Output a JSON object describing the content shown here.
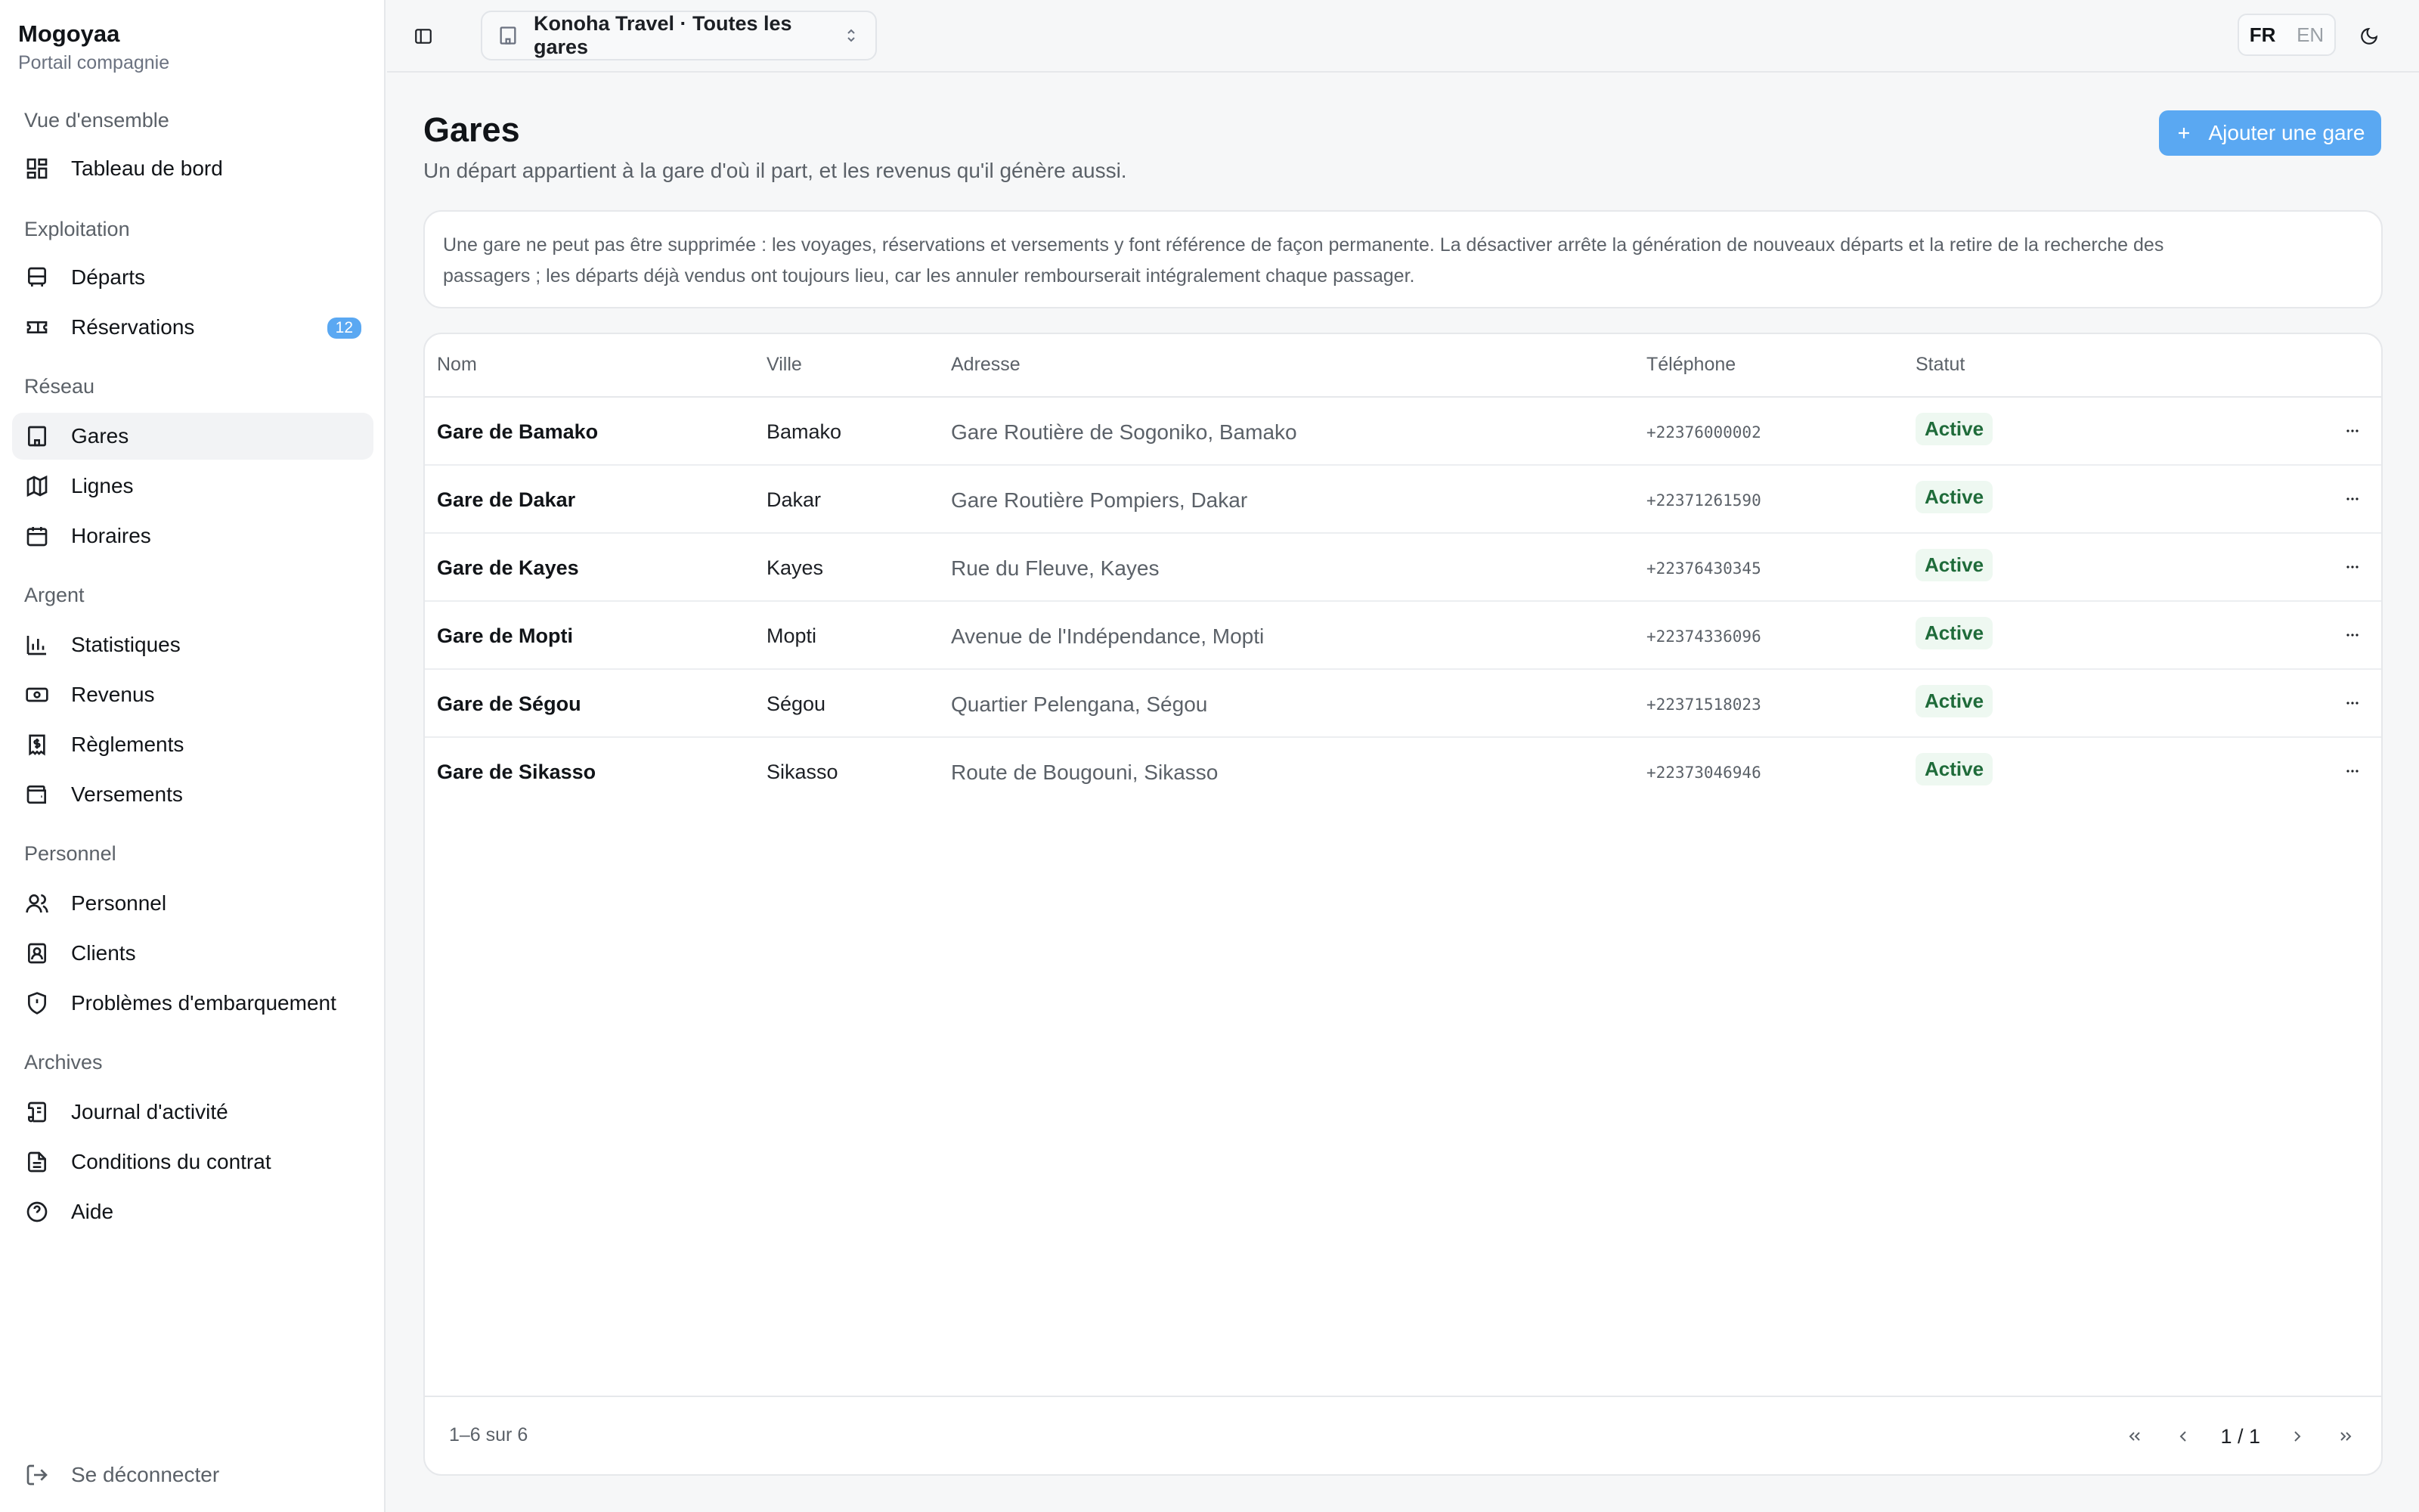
{
  "brand": {
    "name": "Mogoyaa",
    "subtitle": "Portail compagnie"
  },
  "sidebar": {
    "groups": [
      {
        "title": "Vue d'ensemble",
        "items": [
          {
            "label": "Tableau de bord",
            "icon": "dashboard-icon"
          }
        ]
      },
      {
        "title": "Exploitation",
        "items": [
          {
            "label": "Départs",
            "icon": "bus-icon"
          },
          {
            "label": "Réservations",
            "icon": "ticket-icon",
            "badge": "12"
          }
        ]
      },
      {
        "title": "Réseau",
        "items": [
          {
            "label": "Gares",
            "icon": "building-icon",
            "active": true
          },
          {
            "label": "Lignes",
            "icon": "map-icon"
          },
          {
            "label": "Horaires",
            "icon": "calendar-icon"
          }
        ]
      },
      {
        "title": "Argent",
        "items": [
          {
            "label": "Statistiques",
            "icon": "bar-chart-icon"
          },
          {
            "label": "Revenus",
            "icon": "banknote-icon"
          },
          {
            "label": "Règlements",
            "icon": "receipt-icon"
          },
          {
            "label": "Versements",
            "icon": "wallet-icon"
          }
        ]
      },
      {
        "title": "Personnel",
        "items": [
          {
            "label": "Personnel",
            "icon": "users-icon"
          },
          {
            "label": "Clients",
            "icon": "contact-icon"
          },
          {
            "label": "Problèmes d'embarquement",
            "icon": "shield-alert-icon"
          }
        ]
      },
      {
        "title": "Archives",
        "items": [
          {
            "label": "Journal d'activité",
            "icon": "scroll-icon"
          },
          {
            "label": "Conditions du contrat",
            "icon": "file-icon"
          },
          {
            "label": "Aide",
            "icon": "help-circle-icon"
          }
        ]
      }
    ],
    "logout": "Se déconnecter"
  },
  "topbar": {
    "company": "Konoha Travel · Toutes les gares",
    "lang_active": "FR",
    "lang_other": "EN"
  },
  "page": {
    "title": "Gares",
    "subtitle": "Un départ appartient à la gare d'où il part, et les revenus qu'il génère aussi.",
    "add_button": "Ajouter une gare",
    "notice_line1": "Une gare ne peut pas être supprimée : les voyages, réservations et versements y font référence de façon permanente. La désactiver arrête la génération de nouveaux départs et la retire de la recherche des",
    "notice_line2": "passagers ; les départs déjà vendus ont toujours lieu, car les annuler rembourserait intégralement chaque passager."
  },
  "table": {
    "headers": {
      "name": "Nom",
      "city": "Ville",
      "address": "Adresse",
      "phone": "Téléphone",
      "status": "Statut"
    },
    "rows": [
      {
        "name": "Gare de Bamako",
        "city": "Bamako",
        "address": "Gare Routière de Sogoniko, Bamako",
        "phone": "+22376000002",
        "status": "Active"
      },
      {
        "name": "Gare de Dakar",
        "city": "Dakar",
        "address": "Gare Routière Pompiers, Dakar",
        "phone": "+22371261590",
        "status": "Active"
      },
      {
        "name": "Gare de Kayes",
        "city": "Kayes",
        "address": "Rue du Fleuve, Kayes",
        "phone": "+22376430345",
        "status": "Active"
      },
      {
        "name": "Gare de Mopti",
        "city": "Mopti",
        "address": "Avenue de l'Indépendance, Mopti",
        "phone": "+22374336096",
        "status": "Active"
      },
      {
        "name": "Gare de Ségou",
        "city": "Ségou",
        "address": "Quartier Pelengana, Ségou",
        "phone": "+22371518023",
        "status": "Active"
      },
      {
        "name": "Gare de Sikasso",
        "city": "Sikasso",
        "address": "Route de Bougouni, Sikasso",
        "phone": "+22373046946",
        "status": "Active"
      }
    ],
    "range": "1–6 sur 6",
    "page": "1 / 1"
  },
  "colors": {
    "accent": "#5aa8f2",
    "status_bg": "#eef8f1",
    "status_text": "#1f6b3a"
  }
}
